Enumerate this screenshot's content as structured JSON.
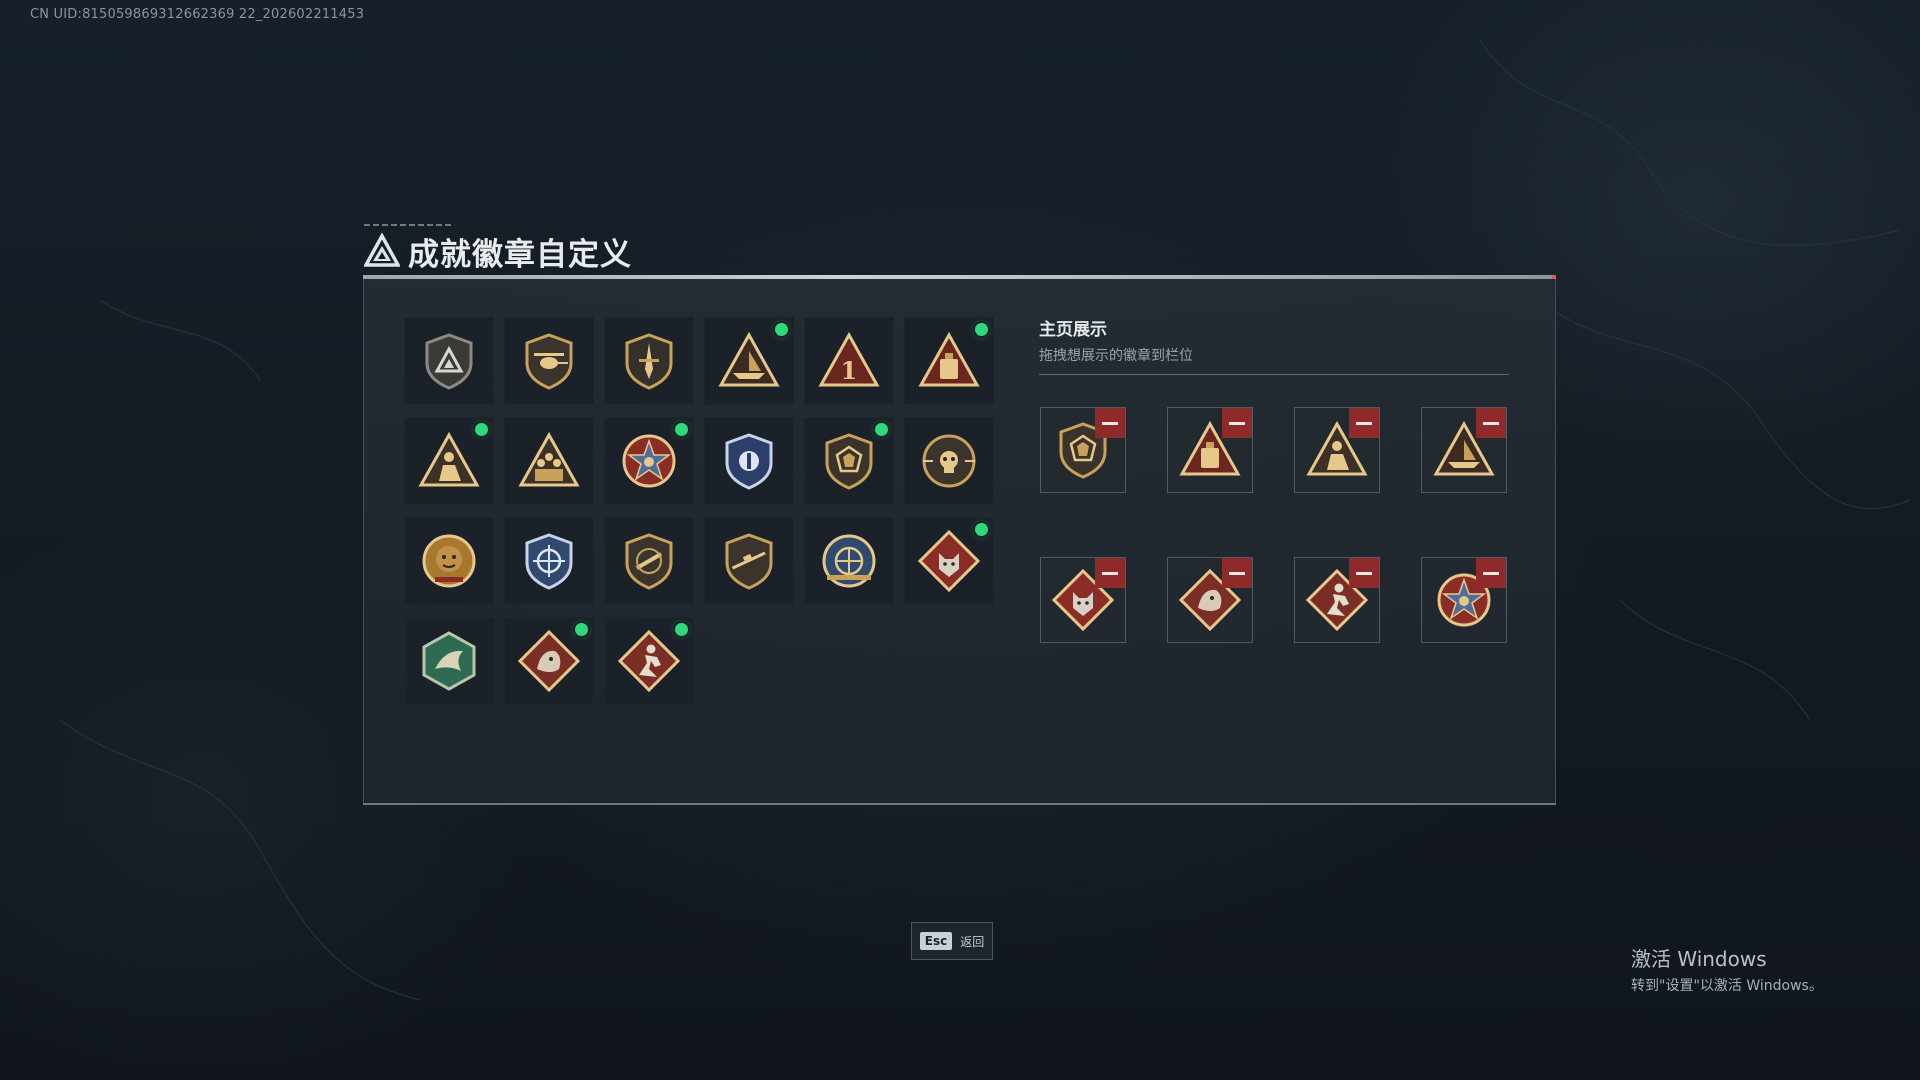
{
  "uid_text": "CN UID:815059869312662369 22_202602211453",
  "title": "成就徽章自定义",
  "badges": [
    {
      "icon": "triangle-shield-emblem-icon",
      "new": false
    },
    {
      "icon": "helicopter-shield-emblem-icon",
      "new": false
    },
    {
      "icon": "blade-shield-emblem-icon",
      "new": false
    },
    {
      "icon": "boat-triangle-emblem-icon",
      "new": true
    },
    {
      "icon": "number-one-triangle-emblem-icon",
      "new": false
    },
    {
      "icon": "vault-triangle-emblem-icon",
      "new": true
    },
    {
      "icon": "soldier-triangle-emblem-icon",
      "new": true
    },
    {
      "icon": "squad-triangle-emblem-icon",
      "new": false
    },
    {
      "icon": "star-medal-emblem-icon",
      "new": true
    },
    {
      "icon": "blue-shield-crest-emblem-icon",
      "new": false
    },
    {
      "icon": "gem-shield-emblem-icon",
      "new": true
    },
    {
      "icon": "skull-crosshair-emblem-icon",
      "new": false
    },
    {
      "icon": "tiger-medal-emblem-icon",
      "new": false
    },
    {
      "icon": "crosshair-sword-shield-emblem-icon",
      "new": false
    },
    {
      "icon": "rifle-shield-emblem-icon",
      "new": false
    },
    {
      "icon": "sniper-shield-emblem-icon",
      "new": false
    },
    {
      "icon": "globe-medal-emblem-icon",
      "new": false
    },
    {
      "icon": "wolf-diamond-emblem-icon",
      "new": true
    },
    {
      "icon": "green-dragon-hexagon-emblem-icon",
      "new": false
    },
    {
      "icon": "dragon-diamond-emblem-icon",
      "new": true
    },
    {
      "icon": "runner-diamond-emblem-icon",
      "new": true
    }
  ],
  "showcase": {
    "title": "主页展示",
    "subtitle": "拖拽想展示的徽章到栏位",
    "slots": [
      {
        "icon": "gem-shield-emblem-icon"
      },
      {
        "icon": "vault-triangle-emblem-icon"
      },
      {
        "icon": "soldier-triangle-emblem-icon"
      },
      {
        "icon": "boat-triangle-emblem-icon"
      },
      {
        "icon": "wolf-diamond-emblem-icon"
      },
      {
        "icon": "dragon-diamond-emblem-icon"
      },
      {
        "icon": "runner-diamond-emblem-icon"
      },
      {
        "icon": "star-medal-emblem-icon"
      }
    ]
  },
  "esc": {
    "key": "Esc",
    "label": "返回"
  },
  "watermark": {
    "line1": "激活 Windows",
    "line2": "转到\"设置\"以激活 Windows。"
  },
  "colors": {
    "gold": "#c9a25a",
    "new_dot": "#2fd87a",
    "remove_button": "#8f2a2a",
    "panel_bg": "#242c34"
  }
}
